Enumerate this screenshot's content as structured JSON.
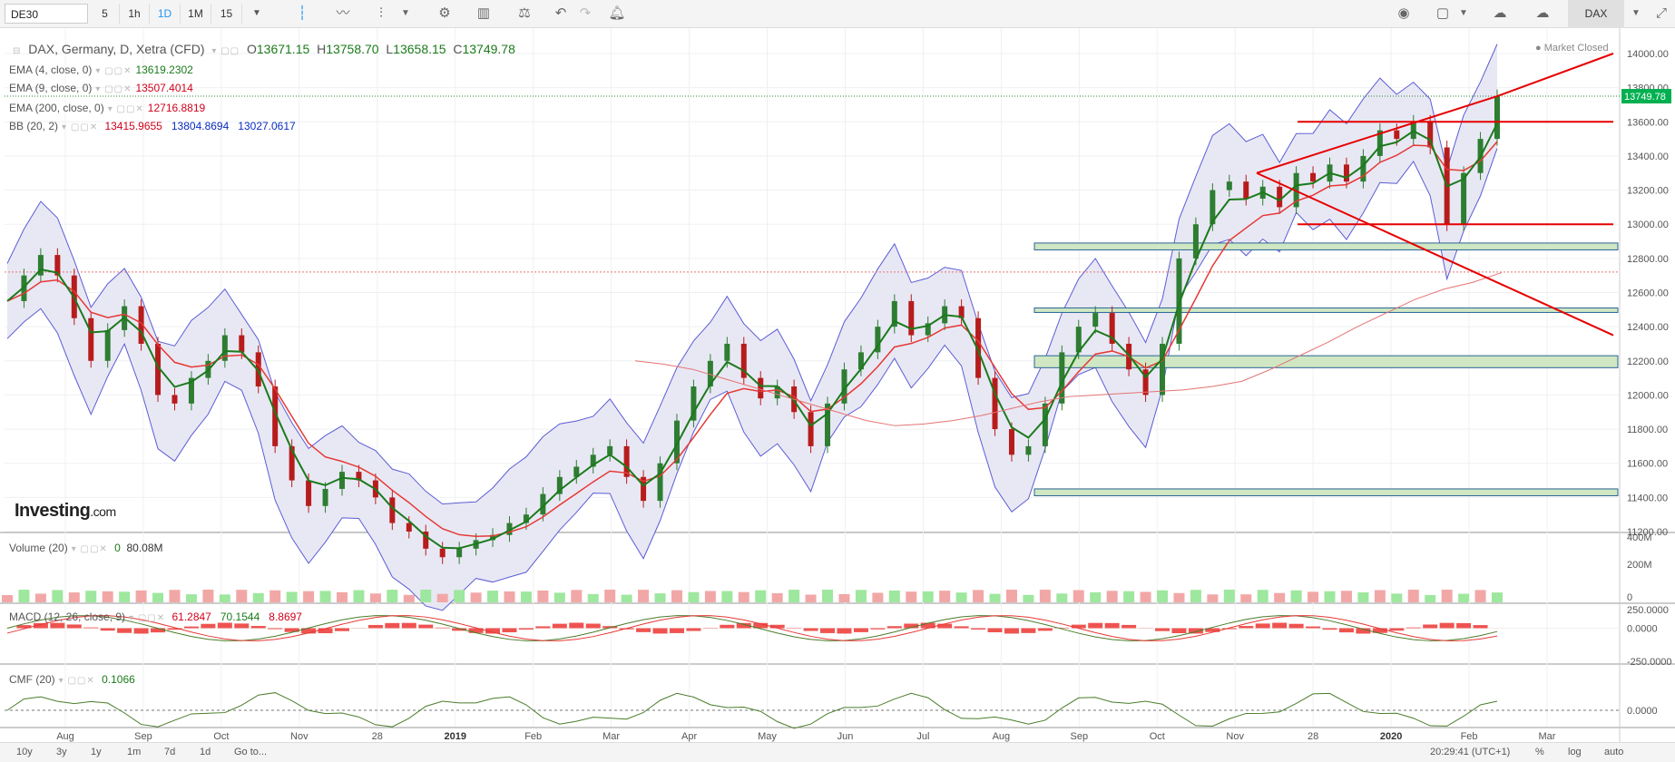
{
  "toolbar": {
    "symbol": "DE30",
    "intervals": [
      "5",
      "1h",
      "1D",
      "1M",
      "15"
    ],
    "active_interval": "1D",
    "exchange_label": "DAX",
    "icons": [
      "candles-icon",
      "line-chart-icon",
      "indicators-icon",
      "settings-icon",
      "bar-style-icon",
      "compare-icon",
      "undo-icon",
      "redo-icon",
      "alert-icon",
      "camera-icon",
      "color-icon",
      "cloud-save-icon",
      "cloud-load-icon",
      "fullscreen-icon"
    ]
  },
  "legend": {
    "main_title": "DAX, Germany, D, Xetra (CFD)",
    "open_label": "O",
    "open": "13671.15",
    "high_label": "H",
    "high": "13758.70",
    "low_label": "L",
    "low": "13658.15",
    "close_label": "C",
    "close": "13749.78",
    "ema4_label": "EMA (4, close, 0)",
    "ema4_value": "13619.2302",
    "ema9_label": "EMA (9, close, 0)",
    "ema9_value": "13507.4014",
    "ema200_label": "EMA (200, close, 0)",
    "ema200_value": "12716.8819",
    "bb_label": "BB (20, 2)",
    "bb_mid": "13415.9655",
    "bb_upper": "13804.8694",
    "bb_lower": "13027.0617",
    "market_status": "Market Closed",
    "volume_label": "Volume (20)",
    "volume_v1": "0",
    "volume_v2": "80.08M",
    "macd_label": "MACD (12, 26, close, 9)",
    "macd_v1": "61.2847",
    "macd_v2": "70.1544",
    "macd_v3": "8.8697",
    "cmf_label": "CMF (20)",
    "cmf_value": "0.1066"
  },
  "logo": {
    "brand": "Investing",
    "suffix": ".com"
  },
  "bottombar": {
    "ranges": [
      "10y",
      "3y",
      "1y",
      "1m",
      "7d",
      "1d",
      "Go to..."
    ],
    "clock": "20:29:41 (UTC+1)",
    "scale_opts": [
      "%",
      "log",
      "auto"
    ]
  },
  "colors": {
    "up": "#2e7d32",
    "down": "#b71c1c",
    "ema4": "#1b7a1b",
    "ema9": "#e53935",
    "ema200": "#e57373",
    "bb_fill": "#e8e8f4",
    "bb_line": "#5c5cd6",
    "trend": "#e60000",
    "zone": "#cfe7c3"
  },
  "chart_data": {
    "type": "candlestick",
    "title": "DAX, Germany, D, Xetra (CFD)",
    "x_ticks": [
      "Aug",
      "Sep",
      "Oct",
      "Nov",
      "28",
      "2019",
      "Feb",
      "Mar",
      "Apr",
      "May",
      "Jun",
      "Jul",
      "Aug",
      "Sep",
      "Oct",
      "Nov",
      "28",
      "2020",
      "Feb",
      "Mar"
    ],
    "y_ticks": [
      11200,
      11400,
      11600,
      11800,
      12000,
      12200,
      12400,
      12600,
      12800,
      13000,
      13200,
      13400,
      13600,
      13800,
      14000
    ],
    "ylim": [
      11200,
      14000
    ],
    "last_price": "13749.78",
    "close_series": [
      12550,
      12700,
      12820,
      12700,
      12450,
      12200,
      12380,
      12520,
      12300,
      12000,
      11950,
      12100,
      12200,
      12350,
      12250,
      12050,
      11700,
      11500,
      11350,
      11450,
      11550,
      11500,
      11400,
      11250,
      11200,
      11100,
      11050,
      11100,
      11150,
      11180,
      11250,
      11300,
      11420,
      11520,
      11580,
      11650,
      11700,
      11520,
      11380,
      11600,
      11850,
      12050,
      12200,
      12300,
      12100,
      11980,
      12050,
      11900,
      11700,
      11950,
      12150,
      12250,
      12400,
      12550,
      12350,
      12420,
      12520,
      12450,
      12100,
      11800,
      11650,
      11700,
      11950,
      12250,
      12400,
      12480,
      12300,
      12150,
      12000,
      12300,
      12800,
      13000,
      13200,
      13250,
      13150,
      13220,
      13100,
      13300,
      13250,
      13350,
      13250,
      13400,
      13550,
      13500,
      13600,
      13450,
      13000,
      13300,
      13500,
      13749.78
    ],
    "ema200_series": [
      12200,
      12180,
      12150,
      12100,
      12050,
      12000,
      11950,
      11900,
      11850,
      11820,
      11830,
      11850,
      11880,
      11920,
      11960,
      11990,
      12000,
      12010,
      12020,
      12030,
      12050,
      12080,
      12150,
      12230,
      12310,
      12400,
      12480,
      12560,
      12620,
      12660,
      12716.88
    ],
    "trendlines": [
      {
        "from": [
          "Nov",
          13300
        ],
        "to": [
          "Feb",
          13750
        ]
      },
      {
        "from": [
          "Nov",
          13300
        ],
        "to": [
          "Mar",
          12350
        ]
      },
      {
        "from": [
          "Feb",
          13750
        ],
        "to": [
          "Mar",
          14000
        ]
      }
    ],
    "horizontal_levels": [
      13600,
      13000,
      12720
    ],
    "zones": [
      [
        12850,
        12890
      ],
      [
        12490,
        12510
      ],
      [
        12160,
        12230
      ],
      [
        11410,
        11450
      ]
    ],
    "volume": {
      "ylim": [
        "0",
        "400M"
      ],
      "ticks": [
        "400M",
        "200M",
        "0"
      ],
      "last": "80.08M"
    },
    "macd": {
      "ticks": [
        "250.0000",
        "0.0000",
        "-250.0000"
      ],
      "macd": 61.2847,
      "signal": 70.1544,
      "hist": 8.8697
    },
    "cmf": {
      "ticks": [
        "0.0000"
      ],
      "value": 0.1066
    }
  }
}
